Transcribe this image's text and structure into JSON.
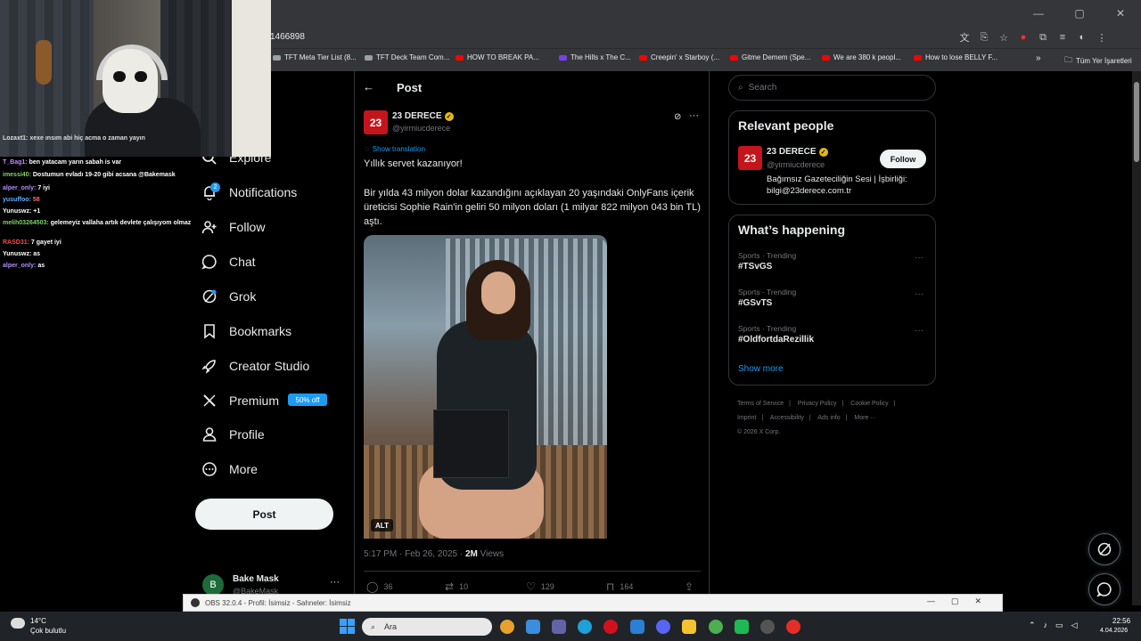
{
  "browser": {
    "url": "1466898",
    "bookmarks": [
      {
        "label": "TFT Meta Tier List (8...",
        "icon": "tft-icon"
      },
      {
        "label": "TFT Deck Team Com...",
        "icon": "tft-icon"
      },
      {
        "label": "HOW TO BREAK PA...",
        "icon": "youtube-icon"
      },
      {
        "label": "The Hills x The C...",
        "icon": "twitch-icon"
      },
      {
        "label": "Creepin' x Starboy (...",
        "icon": "youtube-icon"
      },
      {
        "label": "Gitme Demem (Spe...",
        "icon": "youtube-icon"
      },
      {
        "label": "We are 380 k peopl...",
        "icon": "youtube-icon"
      },
      {
        "label": "How to lose BELLY F...",
        "icon": "youtube-icon"
      }
    ],
    "bookmarks_overflow": "»",
    "all_bookmarks": "Tüm Yer İşaretleri"
  },
  "chat": [
    {
      "user": "T_Bag1:",
      "msg": "ben yatacam yarın sabah is var",
      "color": "#c58bff"
    },
    {
      "user": "imessi40:",
      "msg": "Dostumun evladı 19-20 gibi acsana @Bakemask",
      "color": "#7fd36a"
    },
    {
      "user": "alper_only:",
      "msg": "7 iyi",
      "color": "#b48cff"
    },
    {
      "user": "Yunuswz:",
      "msg": "+1",
      "color": "#ffffff"
    },
    {
      "user": "yusuffoo:",
      "msg": "58",
      "color": "#5fb0ff"
    },
    {
      "user": "melih03264503:",
      "msg": "gelemeyiz vallaha artık devlete çalışıyom olmaz",
      "color": "#7fd36a"
    },
    {
      "user": "RASD31:",
      "msg": "7 gayet iyi",
      "color": "#ff4b4b"
    },
    {
      "user": "Yunuswz:",
      "msg": "as",
      "color": "#ffffff"
    },
    {
      "user": "alper_only:",
      "msg": "as",
      "color": "#b48cff"
    }
  ],
  "chat_top": "Lozaxt1: xexe ınsım abi hiç acma o zaman yayın",
  "nav": {
    "explore": "Explore",
    "notifications": "Notifications",
    "notifications_badge": "2",
    "follow": "Follow",
    "chat": "Chat",
    "grok": "Grok",
    "bookmarks": "Bookmarks",
    "creator_studio": "Creator Studio",
    "premium": "Premium",
    "premium_badge": "50% off",
    "profile": "Profile",
    "more": "More",
    "post_button": "Post"
  },
  "account": {
    "initial": "B",
    "name": "Bake Mask",
    "handle": "@BakeMask",
    "more": "···"
  },
  "post": {
    "header": "Post",
    "author_logo": "23",
    "author_name": "23 DERECE",
    "author_handle": "@yirmiucderece",
    "show_translation": "Show translation",
    "title": "Yıllık servet kazanıyor!",
    "body": "Bir yılda 43 milyon dolar kazandığını açıklayan 20 yaşındaki OnlyFans içerik üreticisi Sophie Rain'in geliri 50 milyon doları (1 milyar 822 milyon 043 bin TL) aştı.",
    "alt": "ALT",
    "timestamp": "5:17 PM · Feb 26, 2025 · ",
    "views_count": "2M",
    "views_label": " Views",
    "replies": "36",
    "reposts": "10",
    "likes": "129",
    "bookmarks": "164"
  },
  "right": {
    "search_placeholder": "Search",
    "relevant_title": "Relevant people",
    "rel_logo": "23",
    "rel_name": "23 DERECE",
    "rel_handle": "@yirmiucderece",
    "rel_bio": "Bağımsız Gazeteciliğin Sesi | İşbirliği: bilgi@23derece.com.tr",
    "follow": "Follow",
    "happening_title": "What’s happening",
    "trends": [
      {
        "meta": "Sports · Trending",
        "tag": "#TSvGS"
      },
      {
        "meta": "Sports · Trending",
        "tag": "#GSvTS"
      },
      {
        "meta": "Sports · Trending",
        "tag": "#OldfortdaRezillik"
      }
    ],
    "show_more": "Show more",
    "footer": [
      "Terms of Service",
      "|",
      "Privacy Policy",
      "|",
      "Cookie Policy",
      "|",
      "Imprint",
      "|",
      "Accessibility",
      "|",
      "Ads info",
      "|",
      "More ···",
      "© 2026 X Corp."
    ]
  },
  "obs": {
    "title": "OBS 32.0.4 - Profil: İsimsiz - Sahneler: İsimsiz"
  },
  "taskbar": {
    "temp": "14°C",
    "weather": "Çok bulutlu",
    "search": "Ara",
    "time": "22:56",
    "date": "4.04.2026"
  },
  "colors": {
    "accent": "#1d9bf0",
    "brand_red": "#c4151c",
    "verified": "#e2b719"
  }
}
